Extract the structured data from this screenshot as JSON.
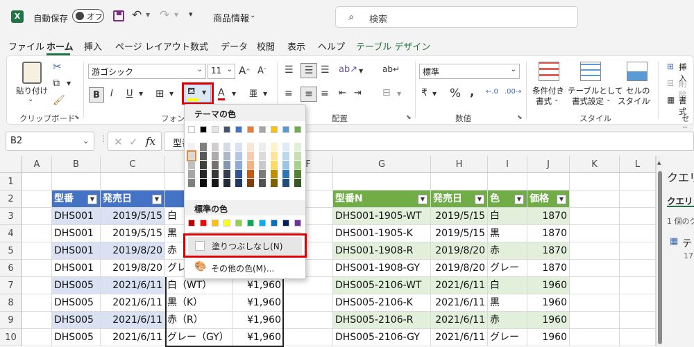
{
  "titlebar": {
    "autosave_label": "自動保存",
    "autosave_state": "オフ",
    "doc_name": "商品情報",
    "search_placeholder": "検索"
  },
  "menu": [
    "ファイル",
    "ホーム",
    "挿入",
    "ページ レイアウト",
    "数式",
    "データ",
    "校閲",
    "表示",
    "ヘルプ",
    "テーブル デザイン"
  ],
  "ribbon": {
    "clipboard": {
      "paste_label": "貼り付け",
      "group_label": "クリップボード"
    },
    "font": {
      "font_name": "游ゴシック",
      "font_size": "11",
      "group_label": "フォント"
    },
    "alignment": {
      "group_label": "配置"
    },
    "number": {
      "format": "標準",
      "group_label": "数値"
    },
    "styles": {
      "conditional_l1": "条件付き",
      "conditional_l2": "書式",
      "table_l1": "テーブルとして",
      "table_l2": "書式設定",
      "cell_l1": "セルの",
      "cell_l2": "スタイル",
      "group_label": "スタイル"
    },
    "cells": {
      "insert": "挿入",
      "delete": "削除",
      "format": "書式",
      "group_label": "セル"
    }
  },
  "formula_bar": {
    "name_box": "B2",
    "fx": "fx",
    "content": "型番"
  },
  "columns": [
    "A",
    "B",
    "C",
    "D",
    "E",
    "F",
    "G",
    "H",
    "I",
    "J",
    "K",
    "L"
  ],
  "rows": [
    "1",
    "2",
    "3",
    "4",
    "5",
    "6",
    "7",
    "8",
    "9",
    "10"
  ],
  "table1": {
    "headers": [
      "型番",
      "発売日",
      "",
      ""
    ],
    "rows": [
      [
        "DHS001",
        "2019/5/15",
        "白",
        ""
      ],
      [
        "DHS001",
        "2019/5/15",
        "黒",
        ""
      ],
      [
        "DHS001",
        "2019/8/20",
        "赤",
        ""
      ],
      [
        "DHS001",
        "2019/8/20",
        "グレ",
        ""
      ],
      [
        "DHS005",
        "2021/6/11",
        "白（WT）",
        "¥1,960"
      ],
      [
        "DHS005",
        "2021/6/11",
        "黒（K）",
        "¥1,960"
      ],
      [
        "DHS005",
        "2021/6/11",
        "赤（R）",
        "¥1,960"
      ],
      [
        "DHS005",
        "2021/6/11",
        "グレー（GY）",
        "¥1,960"
      ]
    ]
  },
  "table2": {
    "headers": [
      "型番N",
      "発売日",
      "色",
      "価格"
    ],
    "rows": [
      [
        "DHS001-1905-WT",
        "2019/5/15",
        "白",
        "1870"
      ],
      [
        "DHS001-1905-K",
        "2019/5/15",
        "黒",
        "1870"
      ],
      [
        "DHS001-1908-R",
        "2019/8/20",
        "赤",
        "1870"
      ],
      [
        "DHS001-1908-GY",
        "2019/8/20",
        "グレー",
        "1870"
      ],
      [
        "DHS005-2106-WT",
        "2021/6/11",
        "白",
        "1960"
      ],
      [
        "DHS005-2106-K",
        "2021/6/11",
        "黒",
        "1960"
      ],
      [
        "DHS005-2106-R",
        "2021/6/11",
        "赤",
        "1960"
      ],
      [
        "DHS005-2106-GY",
        "2021/6/11",
        "グレー",
        "1960"
      ]
    ]
  },
  "popup": {
    "theme_title": "テーマの色",
    "standard_title": "標準の色",
    "no_fill": "塗りつぶしなし(N)",
    "more_colors": "その他の色(M)...",
    "theme_top": [
      "#ffffff",
      "#000000",
      "#e7e6e6",
      "#44546a",
      "#4472c4",
      "#ed7d31",
      "#a5a5a5",
      "#ffc000",
      "#5b9bd5",
      "#70ad47"
    ],
    "theme_shades": [
      [
        "#f2f2f2",
        "#d9d9d9",
        "#bfbfbf",
        "#a6a6a6",
        "#808080"
      ],
      [
        "#808080",
        "#595959",
        "#404040",
        "#262626",
        "#0d0d0d"
      ],
      [
        "#d0cece",
        "#aeaaaa",
        "#767171",
        "#3b3838",
        "#171717"
      ],
      [
        "#d6dce4",
        "#adb9ca",
        "#8497b0",
        "#333f4f",
        "#222a35"
      ],
      [
        "#d9e2f3",
        "#b4c6e7",
        "#8eaadb",
        "#2f5496",
        "#1f3864"
      ],
      [
        "#fbe5d5",
        "#f7cbac",
        "#f4b183",
        "#c55a11",
        "#833c0b"
      ],
      [
        "#ededed",
        "#dbdbdb",
        "#c9c9c9",
        "#7b7b7b",
        "#525252"
      ],
      [
        "#fff2cc",
        "#ffe599",
        "#ffd966",
        "#bf9000",
        "#7f6000"
      ],
      [
        "#deebf6",
        "#bdd7ee",
        "#9dc3e6",
        "#2e75b5",
        "#1f4e79"
      ],
      [
        "#e2efd9",
        "#c5e0b3",
        "#a8d08d",
        "#538135",
        "#375623"
      ]
    ],
    "standard": [
      "#c00000",
      "#ff0000",
      "#ffc000",
      "#ffff00",
      "#92d050",
      "#00b050",
      "#00b0f0",
      "#0070c0",
      "#002060",
      "#7030a0"
    ]
  },
  "side_panel": {
    "title": "クエリ",
    "tab": "クエリ",
    "count_text": "1 個のク",
    "item": "テ",
    "item_sub": "17"
  },
  "colors": {
    "accent": "#217346",
    "highlight": "#e00000",
    "table1_header": "#4472c4",
    "table2_header": "#70ad47"
  }
}
